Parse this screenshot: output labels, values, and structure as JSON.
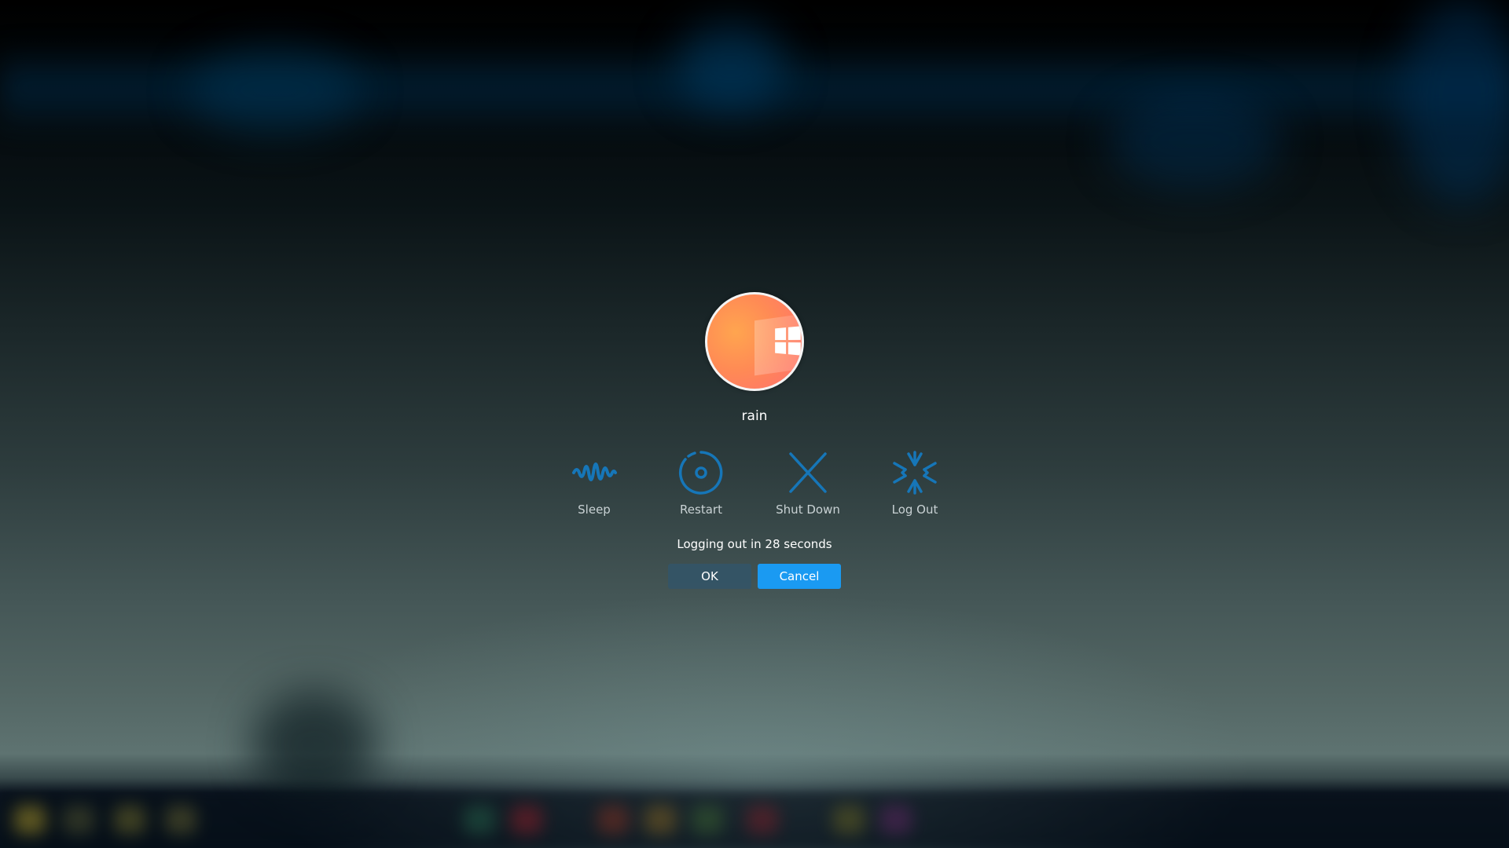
{
  "user": {
    "name": "rain",
    "avatar_icon": "windows-logo"
  },
  "actions": [
    {
      "id": "sleep",
      "label": "Sleep",
      "icon": "sleep-wave-icon"
    },
    {
      "id": "restart",
      "label": "Restart",
      "icon": "restart-ring-icon"
    },
    {
      "id": "shutdown",
      "label": "Shut Down",
      "icon": "shutdown-x-icon"
    },
    {
      "id": "logout",
      "label": "Log Out",
      "icon": "logout-burst-icon"
    }
  ],
  "countdown": {
    "text": "Logging out in 28 seconds"
  },
  "buttons": {
    "ok_label": "OK",
    "cancel_label": "Cancel"
  },
  "colors": {
    "icon_blue": "#1676b8",
    "accent": "#1a9af2",
    "ok_button": "#325569"
  }
}
